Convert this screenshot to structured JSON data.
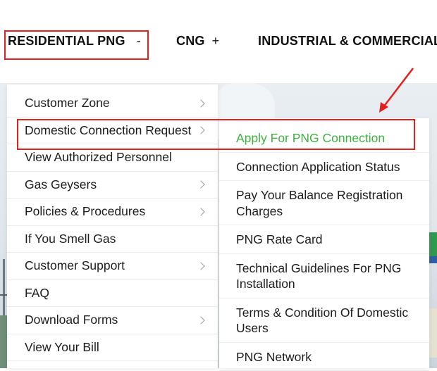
{
  "topnav": {
    "items": [
      {
        "label": "RESIDENTIAL PNG",
        "sign": "-"
      },
      {
        "label": "CNG",
        "sign": "+"
      },
      {
        "label": "INDUSTRIAL & COMMERCIAL",
        "sign": ""
      }
    ]
  },
  "left_menu": {
    "items": [
      {
        "label": "Customer Zone",
        "has_submenu": true
      },
      {
        "label": "Domestic Connection Request",
        "has_submenu": true
      },
      {
        "label": "View Authorized Personnel",
        "has_submenu": false
      },
      {
        "label": "Gas Geysers",
        "has_submenu": true
      },
      {
        "label": "Policies & Procedures",
        "has_submenu": true
      },
      {
        "label": "If You Smell Gas",
        "has_submenu": false
      },
      {
        "label": "Customer Support",
        "has_submenu": true
      },
      {
        "label": "FAQ",
        "has_submenu": false
      },
      {
        "label": "Download Forms",
        "has_submenu": true
      },
      {
        "label": "View Your Bill",
        "has_submenu": false
      }
    ]
  },
  "right_menu": {
    "items": [
      {
        "label": "Apply For PNG Connection",
        "active": true
      },
      {
        "label": "Connection Application Status",
        "active": false
      },
      {
        "label": "Pay Your Balance Registration Charges",
        "active": false
      },
      {
        "label": "PNG Rate Card",
        "active": false
      },
      {
        "label": "Technical Guidelines For PNG Installation",
        "active": false
      },
      {
        "label": "Terms & Condition Of Domestic Users",
        "active": false
      },
      {
        "label": "PNG Network",
        "active": false
      }
    ]
  },
  "colors": {
    "active_link": "#3db340",
    "annotation": "#e3201b",
    "text": "#1c1c1c"
  }
}
